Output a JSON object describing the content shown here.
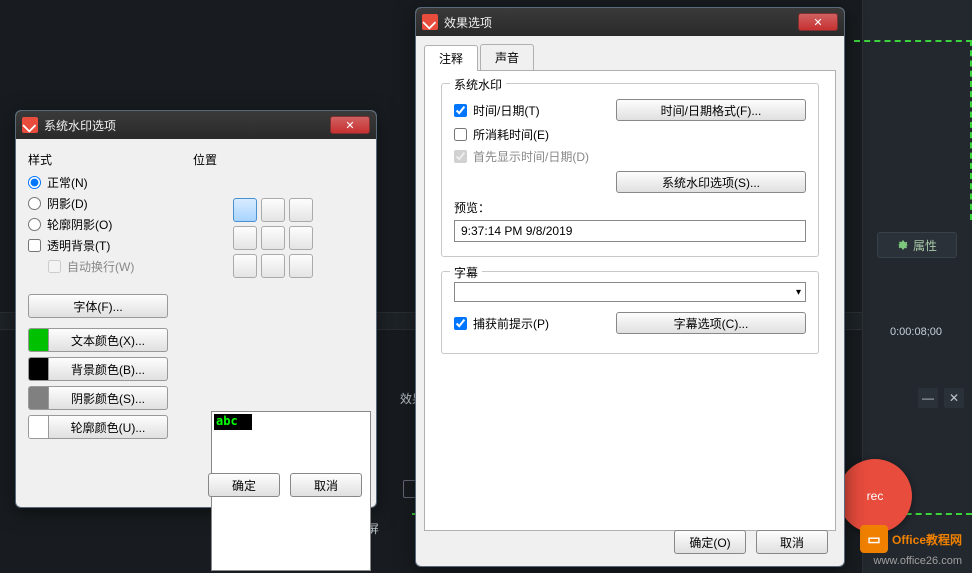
{
  "bg": {
    "properties_btn": "属性",
    "timecode": "0:00:08;00",
    "fx_label": "效果(E",
    "fullscreen": "全屏",
    "rec": "rec",
    "brand_main": "Office教程网",
    "brand_sub": "www.office26.com"
  },
  "dlg1": {
    "title": "系统水印选项",
    "style_label": "样式",
    "position_label": "位置",
    "radios": {
      "normal": "正常(N)",
      "shadow": "阴影(D)",
      "outline_shadow": "轮廓阴影(O)"
    },
    "transparent_bg": "透明背景(T)",
    "auto_wrap": "自动换行(W)",
    "font_btn": "字体(F)...",
    "text_color_btn": "文本颜色(X)...",
    "bg_color_btn": "背景颜色(B)...",
    "shadow_color_btn": "阴影颜色(S)...",
    "outline_color_btn": "轮廓颜色(U)...",
    "preview_text": "abc",
    "ok": "确定",
    "cancel": "取消",
    "swatches": {
      "text": "#00c000",
      "bg": "#000000",
      "shadow": "#808080",
      "outline": "#ffffff"
    }
  },
  "dlg2": {
    "title": "效果选项",
    "tabs": {
      "annotation": "注释",
      "sound": "声音"
    },
    "grp_watermark": "系统水印",
    "chk_timedate": "时间/日期(T)",
    "btn_timedate_fmt": "时间/日期格式(F)...",
    "chk_elapsed": "所消耗时间(E)",
    "chk_showfirst": "首先显示时间/日期(D)",
    "btn_watermark_opts": "系统水印选项(S)...",
    "preview_label": "预览：",
    "preview_value": "9:37:14 PM 9/8/2019",
    "grp_subtitle": "字幕",
    "chk_prompt": "捕获前提示(P)",
    "btn_subtitle_opts": "字幕选项(C)...",
    "ok": "确定(O)",
    "cancel": "取消"
  }
}
